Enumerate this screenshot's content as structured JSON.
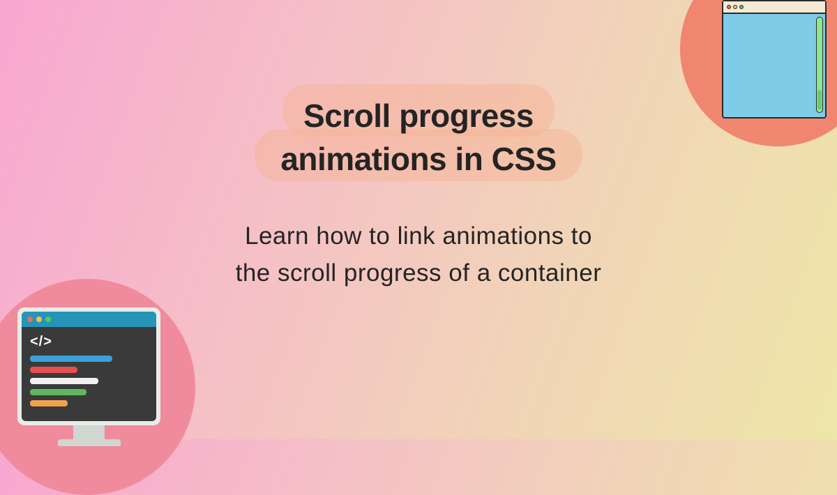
{
  "hero": {
    "title_line1": "Scroll progress",
    "title_line2": "animations in CSS",
    "subtitle_line1": "Learn how to link animations to",
    "subtitle_line2": "the scroll progress of a container"
  },
  "decorations": {
    "browser_dots": [
      "#ed6a5e",
      "#f5bf4f",
      "#61c554"
    ],
    "monitor_dots": [
      "#ed6a5e",
      "#f5bf4f",
      "#61c554"
    ],
    "code_tag": "</>"
  }
}
